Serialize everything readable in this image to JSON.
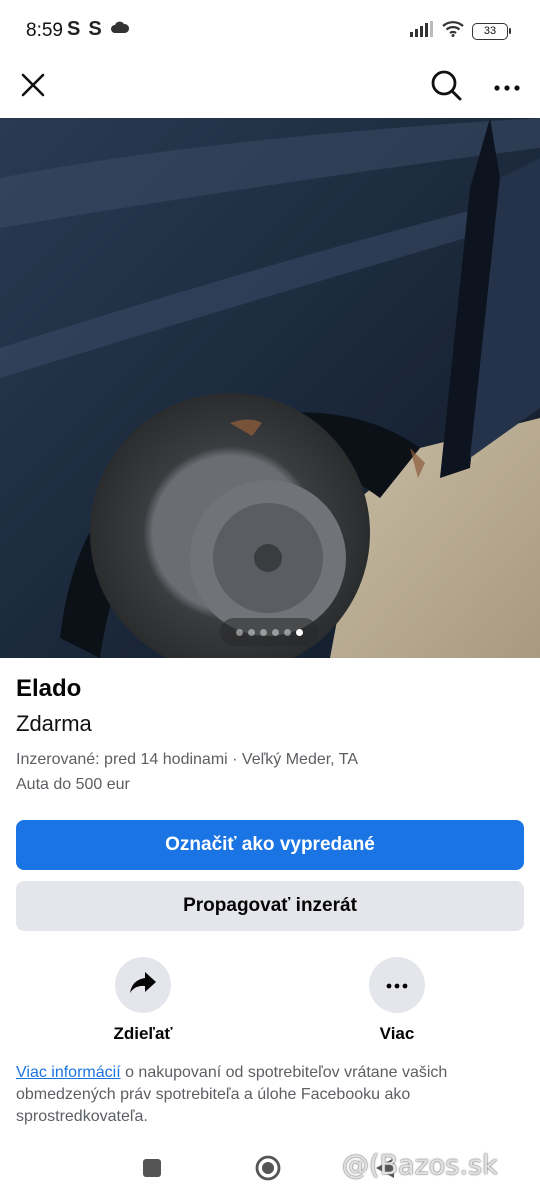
{
  "status_bar": {
    "time": "8:59",
    "notification_glyphs": [
      "S",
      "S"
    ],
    "battery_level": "33"
  },
  "top_bar": {
    "close_icon": "close-icon",
    "search_icon": "search-icon",
    "more_icon": "more-horizontal-icon"
  },
  "photo": {
    "pager": {
      "total": 6,
      "current": 6
    }
  },
  "listing": {
    "title": "Elado",
    "price": "Zdarma",
    "meta": "Inzerované: pred 14 hodinami · Veľký Meder, TA",
    "category": "Auta do 500 eur"
  },
  "buttons": {
    "mark_sold": "Označiť ako vypredané",
    "promote": "Propagovať inzerát"
  },
  "actions": {
    "share_label": "Zdieľať",
    "more_label": "Viac"
  },
  "info": {
    "link_text": "Viac informácií",
    "rest_text": " o nakupovaní od spotrebiteľov vrátane vašich obmedzených práv spotrebiteľa a úlohe Facebooku ako sprostredkovateľa."
  },
  "watermark": {
    "text": "@(Bazos.sk"
  },
  "colors": {
    "accent": "#1b74e4",
    "secondary_button": "#e4e6eb",
    "muted_text": "#5c5f63"
  }
}
